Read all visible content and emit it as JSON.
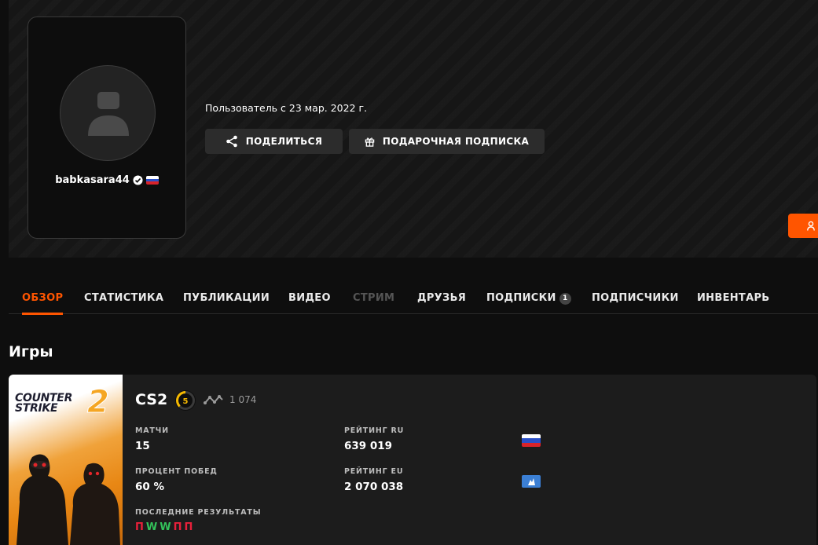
{
  "profile": {
    "username": "babkasara44",
    "member_since": "Пользователь с 23 мар. 2022 г."
  },
  "actions": {
    "share_label": "ПОДЕЛИТЬСЯ",
    "gift_label": "ПОДАРОЧНАЯ ПОДПИСКА"
  },
  "tabs": [
    {
      "label": "ОБЗОР"
    },
    {
      "label": "СТАТИСТИКА"
    },
    {
      "label": "ПУБЛИКАЦИИ"
    },
    {
      "label": "ВИДЕО"
    },
    {
      "label": "СТРИМ"
    },
    {
      "label": "ДРУЗЬЯ"
    },
    {
      "label": "ПОДПИСКИ",
      "badge": "1"
    },
    {
      "label": "ПОДПИСЧИКИ"
    },
    {
      "label": "ИНВЕНТАРЬ"
    }
  ],
  "games_section": {
    "title": "Игры"
  },
  "game": {
    "cover_text": "COUNTER STRIKE",
    "cover_number": "2",
    "name": "CS2",
    "level": "5",
    "elo": "1 074",
    "stats": {
      "matches_label": "МАТЧИ",
      "matches_value": "15",
      "winrate_label": "ПРОЦЕНТ ПОБЕД",
      "winrate_value": "60 %",
      "rating_ru_label": "РЕЙТИНГ RU",
      "rating_ru_value": "639 019",
      "rating_eu_label": "РЕЙТИНГ EU",
      "rating_eu_value": "2 070 038",
      "recent_label": "ПОСЛЕДНИЕ РЕЗУЛЬТАТЫ"
    },
    "recent_results": [
      "П",
      "W",
      "W",
      "П",
      "П"
    ]
  },
  "colors": {
    "accent": "#ff5500",
    "win": "#33c25a",
    "loss": "#e8203a"
  }
}
